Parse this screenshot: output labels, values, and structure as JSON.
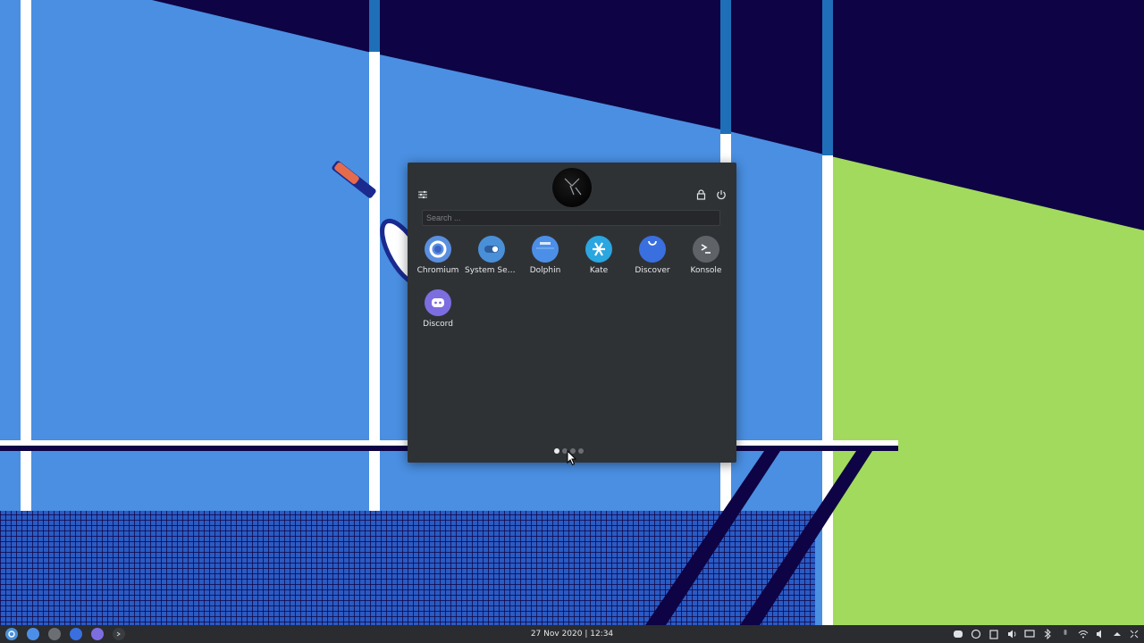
{
  "launcher": {
    "search_placeholder": "Search ...",
    "apps": [
      {
        "name": "Chromium",
        "icon": "chromium-icon",
        "color": "#5a8fe0"
      },
      {
        "name": "System Sett...",
        "icon": "system-settings-icon",
        "color": "#4a90d9"
      },
      {
        "name": "Dolphin",
        "icon": "dolphin-icon",
        "color": "#4c8fe8"
      },
      {
        "name": "Kate",
        "icon": "kate-icon",
        "color": "#2aa6e0"
      },
      {
        "name": "Discover",
        "icon": "discover-icon",
        "color": "#3a6fe0"
      },
      {
        "name": "Konsole",
        "icon": "konsole-icon",
        "color": "#5f6368"
      },
      {
        "name": "Discord",
        "icon": "discord-icon",
        "color": "#7c6ee0"
      }
    ],
    "pages": 4,
    "active_page": 1
  },
  "taskbar": {
    "clock": "27 Nov 2020 | 12:34",
    "pinned": [
      "app-launcher-icon",
      "chromium-icon",
      "system-settings-icon",
      "discover-icon",
      "discord-icon",
      "konsole-icon"
    ],
    "tray": [
      "discord-icon",
      "updates-icon",
      "clipboard-icon",
      "volume-icon",
      "display-icon",
      "bluetooth-icon",
      "microphone-icon",
      "wifi-icon",
      "speaker-icon",
      "expand-tray-icon",
      "show-desktop-icon"
    ]
  },
  "colors": {
    "sky_blue": "#4a8fe2",
    "navy": "#0e0344",
    "lime": "#a2da5e",
    "panel_bg": "#2f3235",
    "taskbar_bg": "#2a2c2f"
  }
}
